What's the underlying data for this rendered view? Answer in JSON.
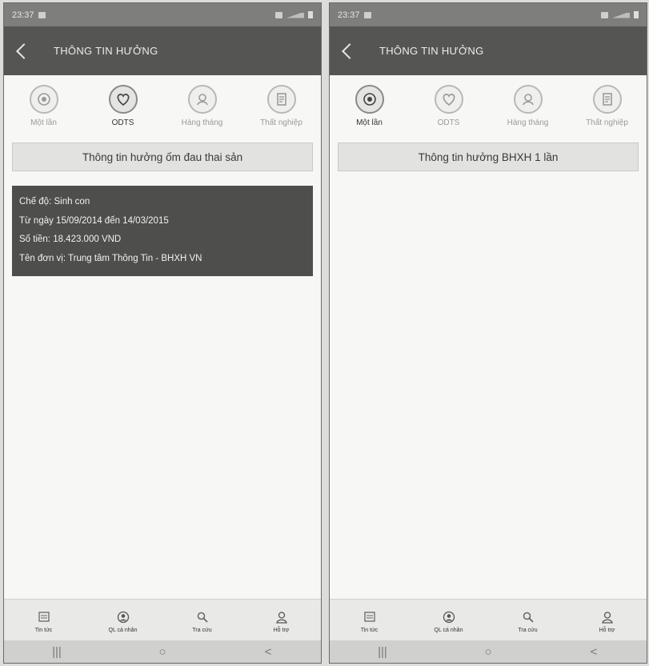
{
  "screens": [
    {
      "status_time": "23:37",
      "appbar_title": "THÔNG TIN HƯỞNG",
      "tabs": [
        {
          "label": "Một lần",
          "icon": "one-time-icon",
          "active": false
        },
        {
          "label": "ODTS",
          "icon": "heart-icon",
          "active": true
        },
        {
          "label": "Hàng tháng",
          "icon": "monthly-icon",
          "active": false
        },
        {
          "label": "Thất nghiệp",
          "icon": "unemployment-icon",
          "active": false
        }
      ],
      "section_title": "Thông tin hưởng ốm đau thai sản",
      "card": {
        "line1": "Chế độ: Sinh con",
        "line2": "Từ ngày 15/09/2014 đến 14/03/2015",
        "line3": "Số tiền: 18.423.000 VND",
        "line4": "Tên đơn vị: Trung tâm Thông Tin - BHXH VN"
      }
    },
    {
      "status_time": "23:37",
      "appbar_title": "THÔNG TIN HƯỞNG",
      "tabs": [
        {
          "label": "Một lần",
          "icon": "one-time-icon",
          "active": true
        },
        {
          "label": "ODTS",
          "icon": "heart-icon",
          "active": false
        },
        {
          "label": "Hàng tháng",
          "icon": "monthly-icon",
          "active": false
        },
        {
          "label": "Thất nghiệp",
          "icon": "unemployment-icon",
          "active": false
        }
      ],
      "section_title": "Thông tin hưởng BHXH 1 lần"
    }
  ],
  "bottom_nav": [
    {
      "label": "Tin tức",
      "icon": "news-icon"
    },
    {
      "label": "QL cá nhân",
      "icon": "personal-icon"
    },
    {
      "label": "Tra cứu",
      "icon": "search-icon"
    },
    {
      "label": "Hỗ trợ",
      "icon": "support-icon"
    }
  ],
  "system_nav": {
    "recent": "|||",
    "home": "○",
    "back": "<"
  },
  "colors": {
    "appbar": "#555553",
    "statusbar": "#7e7e7c",
    "card": "#4e4e4c",
    "section_header": "#e2e2e0",
    "background": "#f7f7f5"
  }
}
